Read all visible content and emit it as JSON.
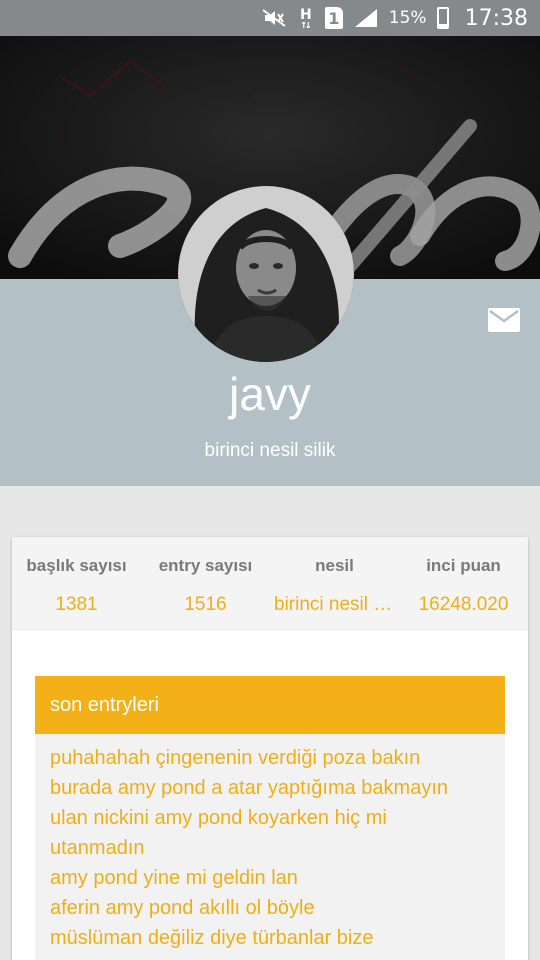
{
  "status_bar": {
    "battery_pct": "15%",
    "time": "17:38",
    "network_letter": "H",
    "sim_slot": "1",
    "icons": [
      "mute-icon",
      "network-h-icon",
      "sim-icon",
      "signal-icon",
      "battery-icon"
    ]
  },
  "profile": {
    "username": "javy",
    "generation": "birinci nesil silik",
    "message_icon": "mail-icon"
  },
  "stats": [
    {
      "label": "başlık sayısı",
      "value": "1381"
    },
    {
      "label": "entry sayısı",
      "value": "1516"
    },
    {
      "label": "nesil",
      "value": "birinci nesil silik"
    },
    {
      "label": "inci puan",
      "value": "16248.020"
    }
  ],
  "entries": {
    "title": "son entryleri",
    "items": [
      "puhahahah çingenenin verdiği poza bakın",
      "burada amy pond a atar yaptığıma bakmayın",
      "ulan nickini amy pond koyarken hiç mi",
      "utanmadın",
      "amy pond yine mi geldin lan",
      "aferin amy pond akıllı ol böyle",
      "müslüman değiliz diye türbanlar bize"
    ]
  },
  "colors": {
    "accent": "#f3b017",
    "header_bg": "#b3c1c7",
    "status_bar": "#86898c"
  }
}
